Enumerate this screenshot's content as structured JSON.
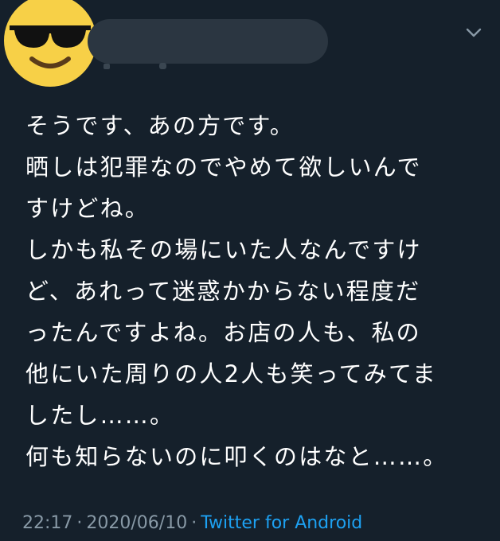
{
  "tweet": {
    "body_lines": [
      "そうです、あの方です。",
      "晒しは犯罪なのでやめて欲しいんで",
      "すけどね。",
      "しかも私その場にいた人なんですけ",
      "ど、あれって迷惑かからない程度だ",
      "ったんですよね。お店の人も、私の",
      "他にいた周りの人2人も笑ってみてま",
      "したし……。",
      "何も知らないのに叩くのはなと……。"
    ],
    "time": "22:17",
    "separator": "·",
    "date": "2020/06/10",
    "source": "Twitter for Android"
  },
  "icons": {
    "avatar": "sunglasses-face-emoji-icon",
    "menu": "chevron-down-icon"
  },
  "colors": {
    "background": "#15202b",
    "text": "#ffffff",
    "meta": "#8899a6",
    "link": "#1da1f2",
    "redaction": "#2b3641",
    "emoji_face": "#f7d047"
  }
}
